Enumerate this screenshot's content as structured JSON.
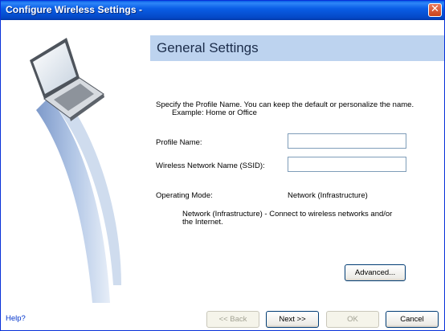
{
  "window": {
    "title": "Configure Wireless Settings -"
  },
  "header": {
    "title": "General Settings"
  },
  "instructions": {
    "line1": "Specify the Profile Name. You can keep the default or personalize the name.",
    "line2": "Example: Home or Office"
  },
  "form": {
    "profile_name_label": "Profile Name:",
    "profile_name_value": "",
    "ssid_label": "Wireless Network Name (SSID):",
    "ssid_value": "",
    "operating_mode_label": "Operating Mode:",
    "operating_mode_value": "Network (Infrastructure)",
    "mode_description_line1": "Network (Infrastructure) - Connect to wireless networks and/or",
    "mode_description_line2": "the Internet."
  },
  "buttons": {
    "advanced_label": "Advanced...",
    "back_label": "<< Back",
    "next_label": "Next >>",
    "ok_label": "OK",
    "cancel_label": "Cancel"
  },
  "help": {
    "label": "Help?"
  },
  "colors": {
    "title_bar": "#0a5ee6",
    "header_band": "#bdd3ef",
    "link": "#0033cc"
  },
  "icons": {
    "close": "close-icon",
    "illustration": "laptop-wireless-illustration"
  }
}
